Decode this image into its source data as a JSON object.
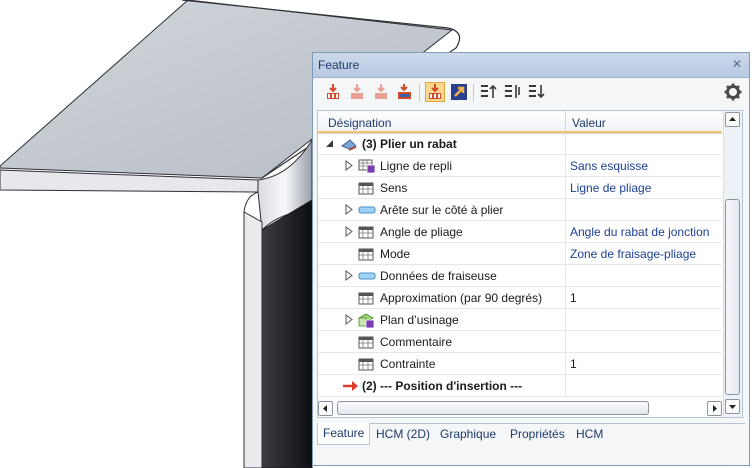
{
  "panel": {
    "title": "Feature",
    "close_glyph": "✕"
  },
  "toolbar": {
    "icons": [
      "feature-execute-icon",
      "feature-execute-until-icon",
      "feature-execute-next-icon",
      "feature-recalculate-icon",
      "feature-active-icon",
      "feature-link-icon",
      "move-up-icon",
      "move-sort-icon",
      "move-down-icon",
      "settings-gear-icon"
    ],
    "accent": "#d04a2a",
    "active_color": "#fbd78f"
  },
  "table": {
    "headers": {
      "designation": "Désignation",
      "valeur": "Valeur"
    },
    "rows": [
      {
        "label": "(3) Plier un rabat",
        "value": "",
        "icon": "sheet-bend-icon",
        "expander": "expanded",
        "bold": true
      },
      {
        "label": "Ligne de repli",
        "value": "Sans esquisse",
        "icon": "grid-sketch-icon",
        "expander": "collapsed"
      },
      {
        "label": "Sens",
        "value": "Ligne de pliage",
        "icon": "grid-param-icon",
        "expander": ""
      },
      {
        "label": "Arête sur le côté à plier",
        "value": "",
        "icon": "edge-icon",
        "expander": "collapsed"
      },
      {
        "label": "Angle de pliage",
        "value": "Angle du rabat de jonction",
        "icon": "grid-param-icon",
        "expander": "collapsed"
      },
      {
        "label": "Mode",
        "value": "Zone de fraisage-pliage",
        "icon": "grid-param-icon",
        "expander": ""
      },
      {
        "label": "Données de fraiseuse",
        "value": "",
        "icon": "edge-icon",
        "expander": "collapsed"
      },
      {
        "label": "Approximation (par 90 degrés)",
        "value": "1",
        "icon": "grid-param-icon",
        "expander": ""
      },
      {
        "label": "Plan d’usinage",
        "value": "",
        "icon": "machining-plane-icon",
        "expander": "collapsed"
      },
      {
        "label": "Commentaire",
        "value": "",
        "icon": "grid-param-icon",
        "expander": ""
      },
      {
        "label": "Contrainte",
        "value": "1",
        "icon": "grid-param-icon",
        "expander": ""
      },
      {
        "label": "(2) --- Position  d'insertion ---",
        "value": "",
        "icon": "red-arrow-icon",
        "expander": "",
        "bold": true
      }
    ]
  },
  "tabs": [
    {
      "label": "Feature",
      "selected": true
    },
    {
      "label": "HCM (2D)",
      "selected": false
    },
    {
      "label": "Graphique",
      "selected": false
    },
    {
      "label": "Propriétés",
      "selected": false
    },
    {
      "label": "HCM",
      "selected": false
    }
  ]
}
